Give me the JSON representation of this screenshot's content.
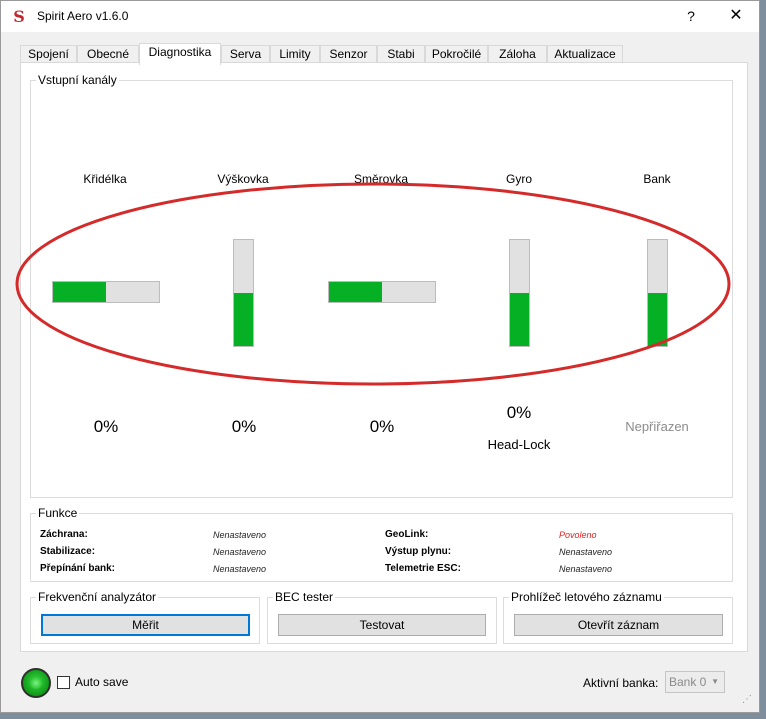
{
  "window": {
    "title": "Spirit Aero v1.6.0",
    "help": "?",
    "close": "✕",
    "logo": "S"
  },
  "tabs": [
    {
      "label": "Spojení"
    },
    {
      "label": "Obecné"
    },
    {
      "label": "Diagnostika",
      "active": true
    },
    {
      "label": "Serva"
    },
    {
      "label": "Limity"
    },
    {
      "label": "Senzor"
    },
    {
      "label": "Stabi"
    },
    {
      "label": "Pokročilé"
    },
    {
      "label": "Záloha"
    },
    {
      "label": "Aktualizace"
    }
  ],
  "input_channels": {
    "title": "Vstupní kanály",
    "channels": [
      {
        "label": "Křidélka",
        "value": "0%",
        "orientation": "horizontal",
        "level": 0.5
      },
      {
        "label": "Výškovka",
        "value": "0%",
        "orientation": "vertical",
        "level": 0.5
      },
      {
        "label": "Směrovka",
        "value": "0%",
        "orientation": "horizontal",
        "level": 0.5
      },
      {
        "label": "Gyro",
        "value": "0%",
        "sub": "Head-Lock",
        "orientation": "vertical",
        "level": 0.5
      },
      {
        "label": "Bank",
        "value": "Nepřiřazen",
        "orientation": "vertical",
        "level": 0.5
      }
    ],
    "highlight_color": "#d42a2a"
  },
  "functions": {
    "title": "Funkce",
    "rows": [
      {
        "label": "Záchrana:",
        "value": "Nenastaveno"
      },
      {
        "label": "Stabilizace:",
        "value": "Nenastaveno"
      },
      {
        "label": "Přepínání bank:",
        "value": "Nenastaveno"
      },
      {
        "label": "GeoLink:",
        "value": "Povoleno",
        "color": "#e02020"
      },
      {
        "label": "Výstup plynu:",
        "value": "Nenastaveno"
      },
      {
        "label": "Telemetrie ESC:",
        "value": "Nenastaveno"
      }
    ]
  },
  "freq_analyzer": {
    "title": "Frekvenční analyzátor",
    "button": "Měřit"
  },
  "bec_tester": {
    "title": "BEC tester",
    "button": "Testovat"
  },
  "flight_log": {
    "title": "Prohlížeč letového záznamu",
    "button": "Otevřít záznam"
  },
  "status_bar": {
    "autosave_label": "Auto save",
    "autosave_checked": false,
    "bank_label": "Aktivní banka:",
    "bank_value": "Bank 0"
  },
  "colors": {
    "bar_fill": "#06b025",
    "status_led": "#16a81f",
    "accent": "#0078d7"
  }
}
